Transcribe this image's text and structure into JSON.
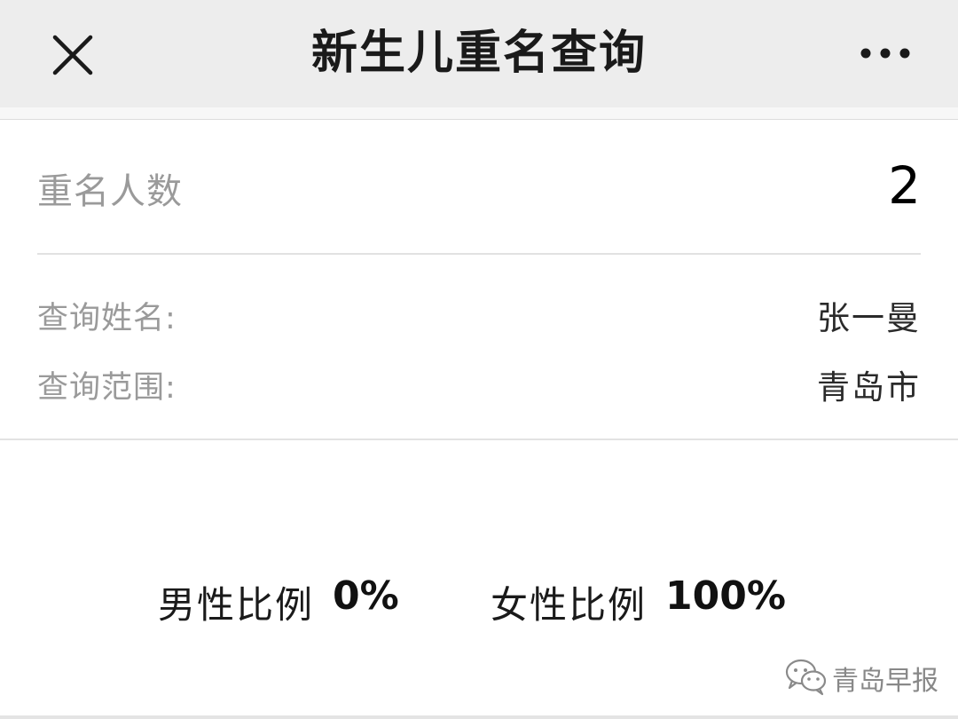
{
  "navbar": {
    "title": "新生儿重名查询",
    "close_icon": "close-icon",
    "more_icon": "more-dots-icon"
  },
  "summary": {
    "count_label": "重名人数",
    "count_value": "2"
  },
  "query": {
    "name_label": "查询姓名:",
    "name_value": "张一曼",
    "range_label": "查询范围:",
    "range_value": "青岛市"
  },
  "ratio": {
    "male_label": "男性比例",
    "male_value": "0%",
    "female_label": "女性比例",
    "female_value": "100%"
  },
  "watermark": {
    "icon": "wechat-icon",
    "text": "青岛早报"
  },
  "colors": {
    "navbar_bg": "#ededed",
    "label_gray": "#9a9a9a",
    "divider": "#e2e2e2"
  }
}
